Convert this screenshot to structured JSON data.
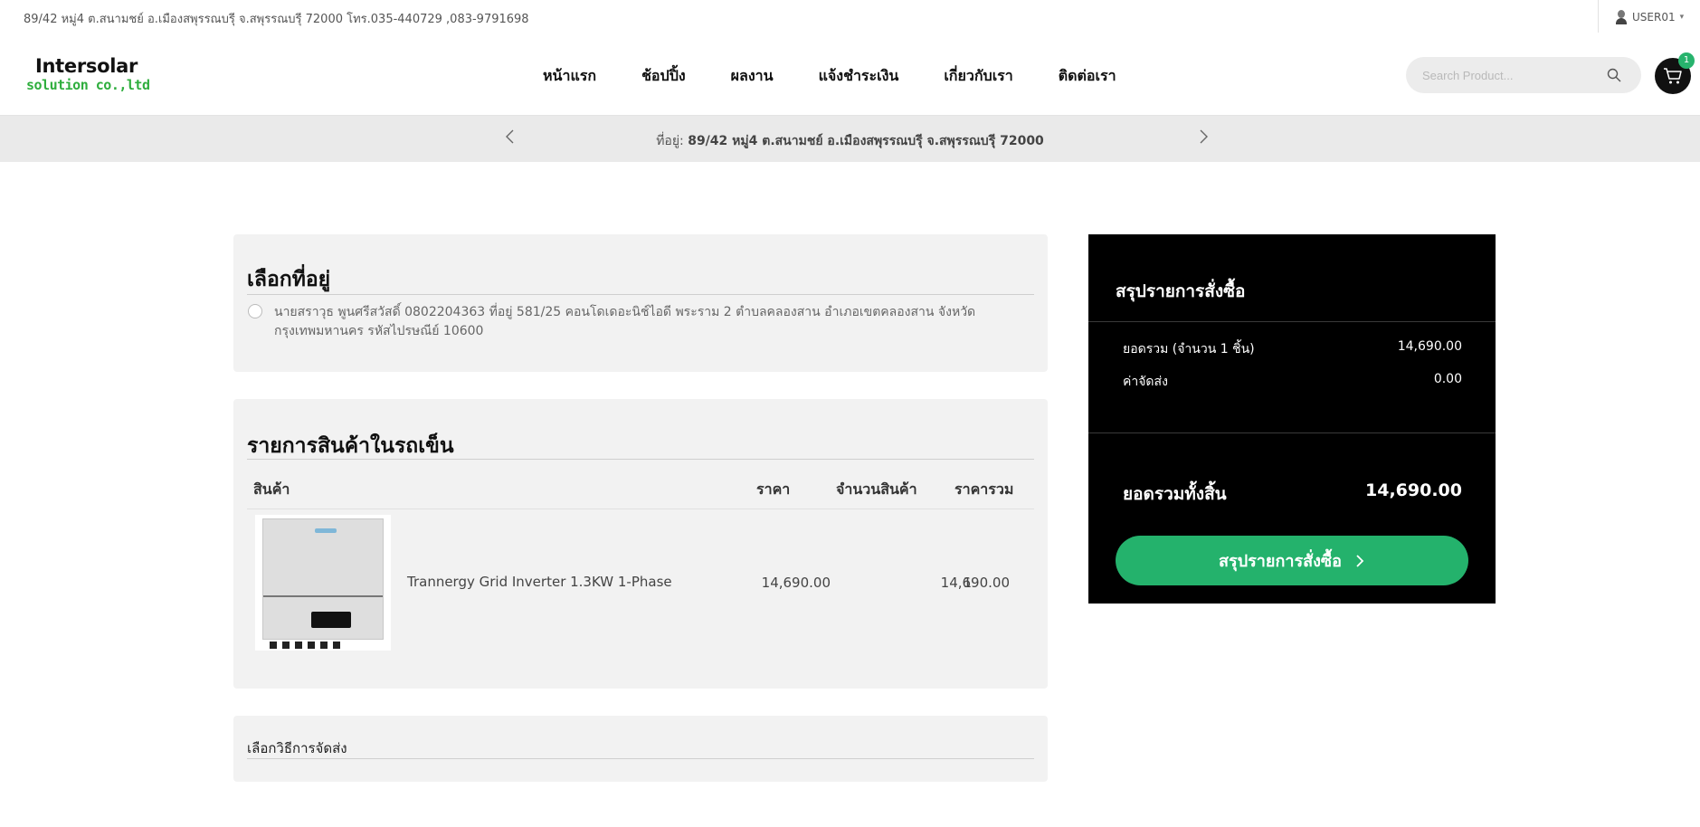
{
  "topbar": {
    "address": "89/42 หมู่4 ต.สนามชย์ อ.เมืองสพุรรณบรุี จ.สพุรรณบรุี 72000 โทร.035-440729 ,083-9791698",
    "user_label": "USER01"
  },
  "header": {
    "logo_line1": "Intersolar",
    "logo_line2": "solution co.,ltd",
    "nav": [
      "หน้าแรก",
      "ช้อปปิ้ง",
      "ผลงาน",
      "แจ้งชำระเงิน",
      "เกี่ยวกับเรา",
      "ติดต่อเรา"
    ],
    "search_placeholder": "Search Product...",
    "cart_count": "1"
  },
  "strip": {
    "prefix": "ที่อยู่:",
    "address": "89/42 หมู่4 ต.สนามชย์ อ.เมืองสพุรรณบรุี จ.สพุรรณบรุี 72000"
  },
  "address_panel": {
    "title": "เลือกที่อยู่",
    "option_text": "นายสราวุธ พูนศรีสวัสดิ์ 0802204363 ที่อยู่ 581/25 คอนโดเดอะนิช์ไอดี พระราม 2 ตำบลคลองสาน อำเภอเขตคลองสาน จังหวัดกรุงเทพมหานคร รหัสไปรษณีย์ 10600"
  },
  "cart_panel": {
    "title": "รายการสินค้าในรถเข็น",
    "columns": [
      "สินค้า",
      "ราคา",
      "จำนวนสินค้า",
      "ราคารวม"
    ],
    "items": [
      {
        "name": "Trannergy Grid Inverter 1.3KW 1-Phase",
        "price": "14,690.00",
        "qty": "1",
        "total": "14,690.00"
      }
    ]
  },
  "shipping_panel": {
    "title": "เลือกวิธีการจัดส่ง"
  },
  "summary": {
    "title": "สรุปรายการสั่งซื้อ",
    "subtotal_label": "ยอดรวม (จำนวน 1 ชิ้น)",
    "subtotal_value": "14,690.00",
    "shipping_label": "ค่าจัดส่ง",
    "shipping_value": "0.00",
    "total_label": "ยอดรวมทั้งสิ้น",
    "total_value": "14,690.00",
    "button_label": "สรุปรายการสั่งซื้อ"
  },
  "colors": {
    "accent_green": "#24b26c",
    "summary_bg": "#000000",
    "panel_bg": "#f2f2f2",
    "strip_bg": "#eaeaea"
  }
}
